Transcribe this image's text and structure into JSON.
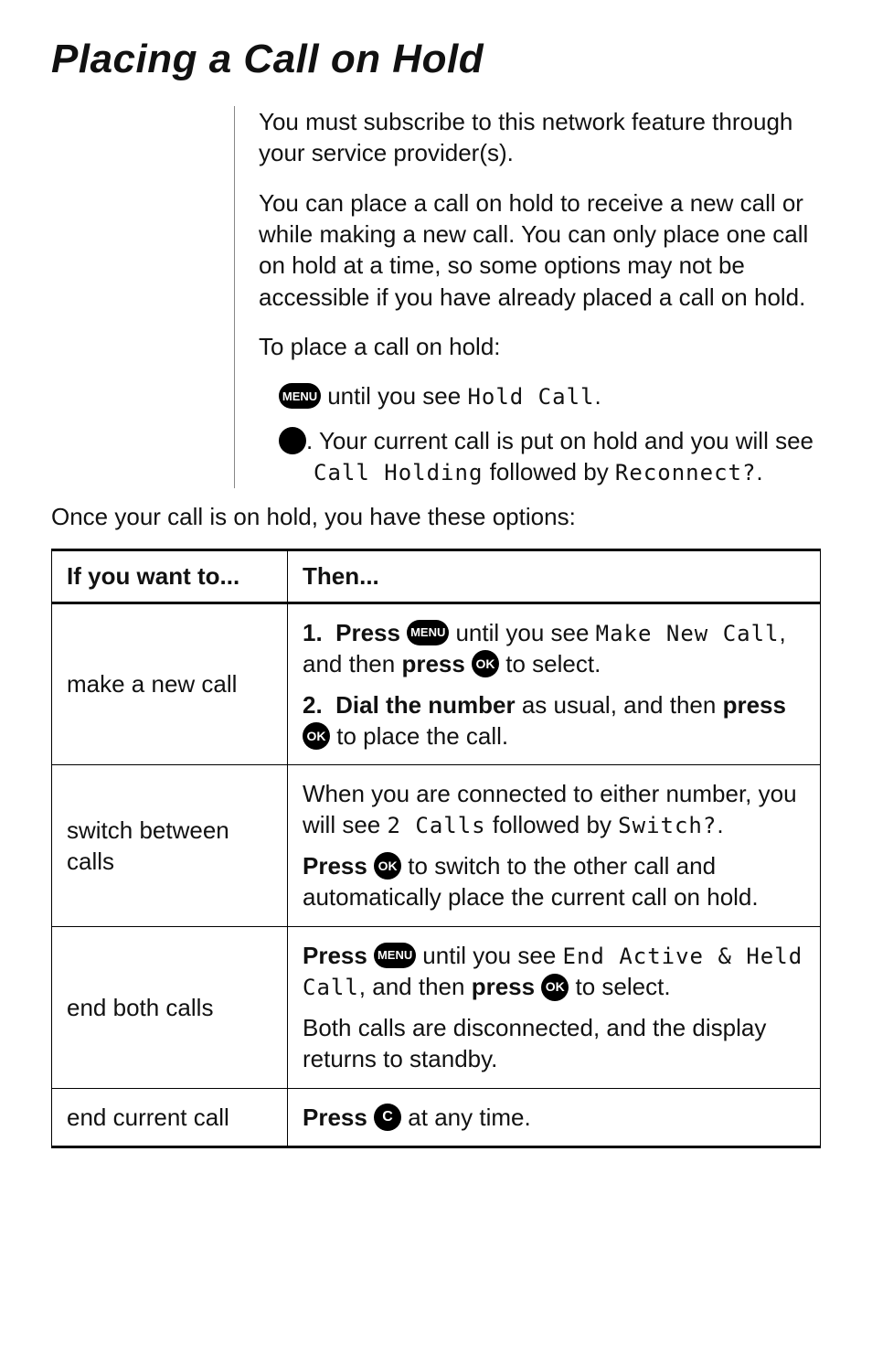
{
  "title": "Placing a Call on Hold",
  "intro_p1": "You must subscribe to this network feature through your service provider(s).",
  "intro_p2": "You can place a call on hold to receive a new call or while making a new call. You can only place one call on hold at a time, so some options may not be accessible if you have already placed a call on hold.",
  "intro_p3": "To place a call on hold:",
  "keys": {
    "menu": "MENU",
    "ok": "OK",
    "c": "C"
  },
  "step1_a": " until you see ",
  "step1_b": "Hold Call",
  "step1_c": ".",
  "step2_a": ". Your current call is put on hold and you will see ",
  "step2_b": "Call Holding",
  "step2_c": " followed by ",
  "step2_d": "Reconnect?",
  "step2_e": ".",
  "post_p": "Once your call is on hold, you have these options:",
  "table": {
    "head_left": "If you want to...",
    "head_right": "Then...",
    "rows": [
      {
        "left": "make a new call",
        "r1_a": "Press ",
        "r1_b": " until you see ",
        "r1_c": "Make New Call",
        "r1_d": ", and then ",
        "r1_e": "press ",
        "r1_f": " to select.",
        "r2_a": "Dial the number",
        "r2_b": " as usual, and then ",
        "r2_c": "press ",
        "r2_d": " to place the call."
      },
      {
        "left": "switch between calls",
        "p1_a": "When you are connected to either number, you will see ",
        "p1_b": "2 Calls",
        "p1_c": " followed by ",
        "p1_d": "Switch?",
        "p1_e": ".",
        "p2_a": "Press ",
        "p2_b": " to switch to the other call and automatically place the current call on hold."
      },
      {
        "left": "end both calls",
        "p1_a": "Press ",
        "p1_b": " until you see ",
        "p1_c": "End Active & Held Call",
        "p1_d": ", and then ",
        "p1_e": "press ",
        "p1_f": " to select.",
        "p2": "Both calls are disconnected, and the display returns to standby."
      },
      {
        "left": "end current call",
        "p1_a": "Press ",
        "p1_b": " at any time."
      }
    ]
  }
}
